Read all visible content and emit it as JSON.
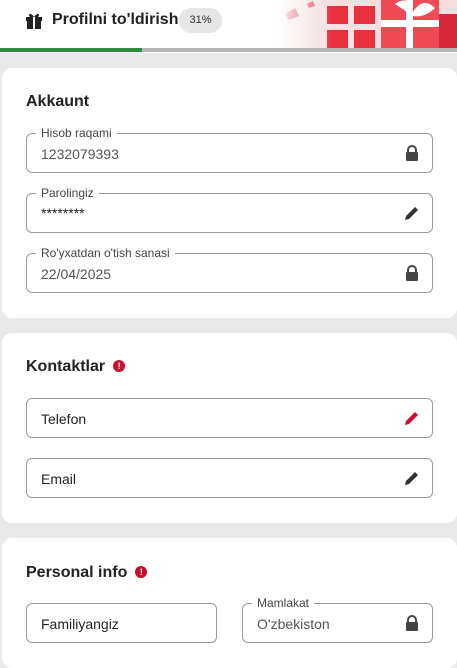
{
  "header": {
    "title": "Profilni to'ldirish",
    "progress_label": "31%",
    "progress_value": 0.31
  },
  "colors": {
    "accent_red": "#c8102e",
    "progress_green": "#2e8b3d"
  },
  "account": {
    "title": "Akkaunt",
    "account_number": {
      "label": "Hisob raqami",
      "value": "1232079393",
      "icon": "lock-icon"
    },
    "password": {
      "label": "Parolingiz",
      "value": "********",
      "icon": "pencil-icon"
    },
    "registration_date": {
      "label": "Ro'yxatdan o'tish sanasi",
      "value": "22/04/2025",
      "icon": "lock-icon"
    }
  },
  "contacts": {
    "title": "Kontaktlar",
    "phone": {
      "placeholder": "Telefon",
      "icon": "pencil-icon"
    },
    "email": {
      "placeholder": "Email",
      "icon": "pencil-icon"
    }
  },
  "personal": {
    "title": "Personal info",
    "surname": {
      "placeholder": "Familiyangiz"
    },
    "country": {
      "label": "Mamlakat",
      "value": "O'zbekiston",
      "icon": "lock-icon"
    }
  }
}
